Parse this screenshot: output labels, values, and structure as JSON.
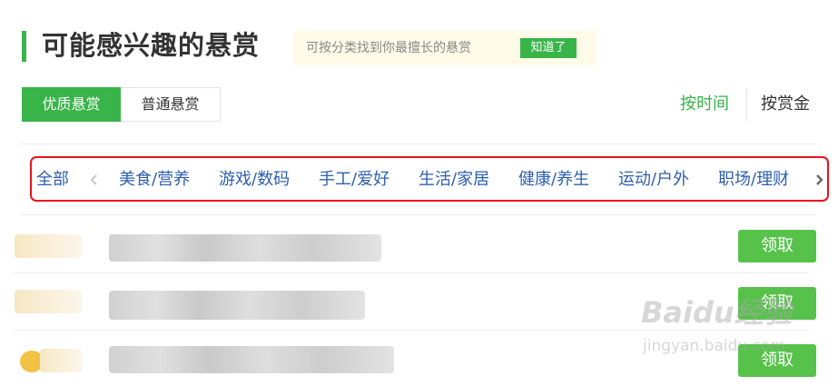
{
  "header": {
    "title": "可能感兴趣的悬赏",
    "tip_text": "可按分类找到你最擅长的悬赏",
    "tip_button": "知道了"
  },
  "tabs": [
    {
      "label": "优质悬赏",
      "active": true
    },
    {
      "label": "普通悬赏",
      "active": false
    }
  ],
  "sort": {
    "by_time": "按时间",
    "by_amount": "按赏金",
    "active": "by_time"
  },
  "categories": {
    "all": "全部",
    "items": [
      "美食/营养",
      "游戏/数码",
      "手工/爱好",
      "生活/家居",
      "健康/养生",
      "运动/户外",
      "职场/理财"
    ],
    "prev_icon": "chevron-left-icon",
    "next_icon": "chevron-right-icon",
    "highlight_color": "#e8141c"
  },
  "questions": [
    {
      "claim_label": "领取"
    },
    {
      "claim_label": "领取"
    },
    {
      "claim_label": "领取"
    }
  ],
  "watermark": {
    "logo": "Baidu经验",
    "url": "jingyan.baidu.com"
  },
  "colors": {
    "accent": "#38b449",
    "claim_button": "#56c24a",
    "category_text": "#2d5fb0"
  }
}
